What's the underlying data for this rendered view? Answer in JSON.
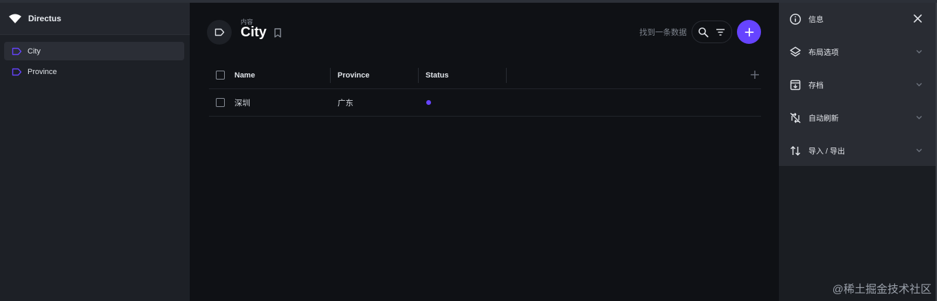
{
  "sidebar": {
    "brand_name": "Directus",
    "brand_icon": "wifi-logo-icon",
    "items": [
      {
        "label": "City",
        "icon": "label-tag-icon",
        "active": true
      },
      {
        "label": "Province",
        "icon": "label-tag-icon",
        "active": false
      }
    ]
  },
  "header": {
    "breadcrumb": "内容",
    "title": "City",
    "search_placeholder": "找到一条数据"
  },
  "table": {
    "columns": [
      "Name",
      "Province",
      "Status"
    ],
    "rows": [
      {
        "name": "深圳",
        "province": "广东",
        "status_color": "#6644ff"
      }
    ]
  },
  "right_panel": {
    "items": [
      {
        "label": "信息",
        "icon": "info-icon"
      },
      {
        "label": "布局选项",
        "icon": "layers-icon"
      },
      {
        "label": "存档",
        "icon": "archive-icon"
      },
      {
        "label": "自动刷新",
        "icon": "sync-disabled-icon"
      },
      {
        "label": "导入 / 导出",
        "icon": "import-export-icon"
      }
    ]
  },
  "colors": {
    "accent": "#6644ff",
    "background": "#0f1115",
    "sidebar": "#1d2026",
    "panel": "#292c33"
  },
  "watermark": "@稀土掘金技术社区"
}
